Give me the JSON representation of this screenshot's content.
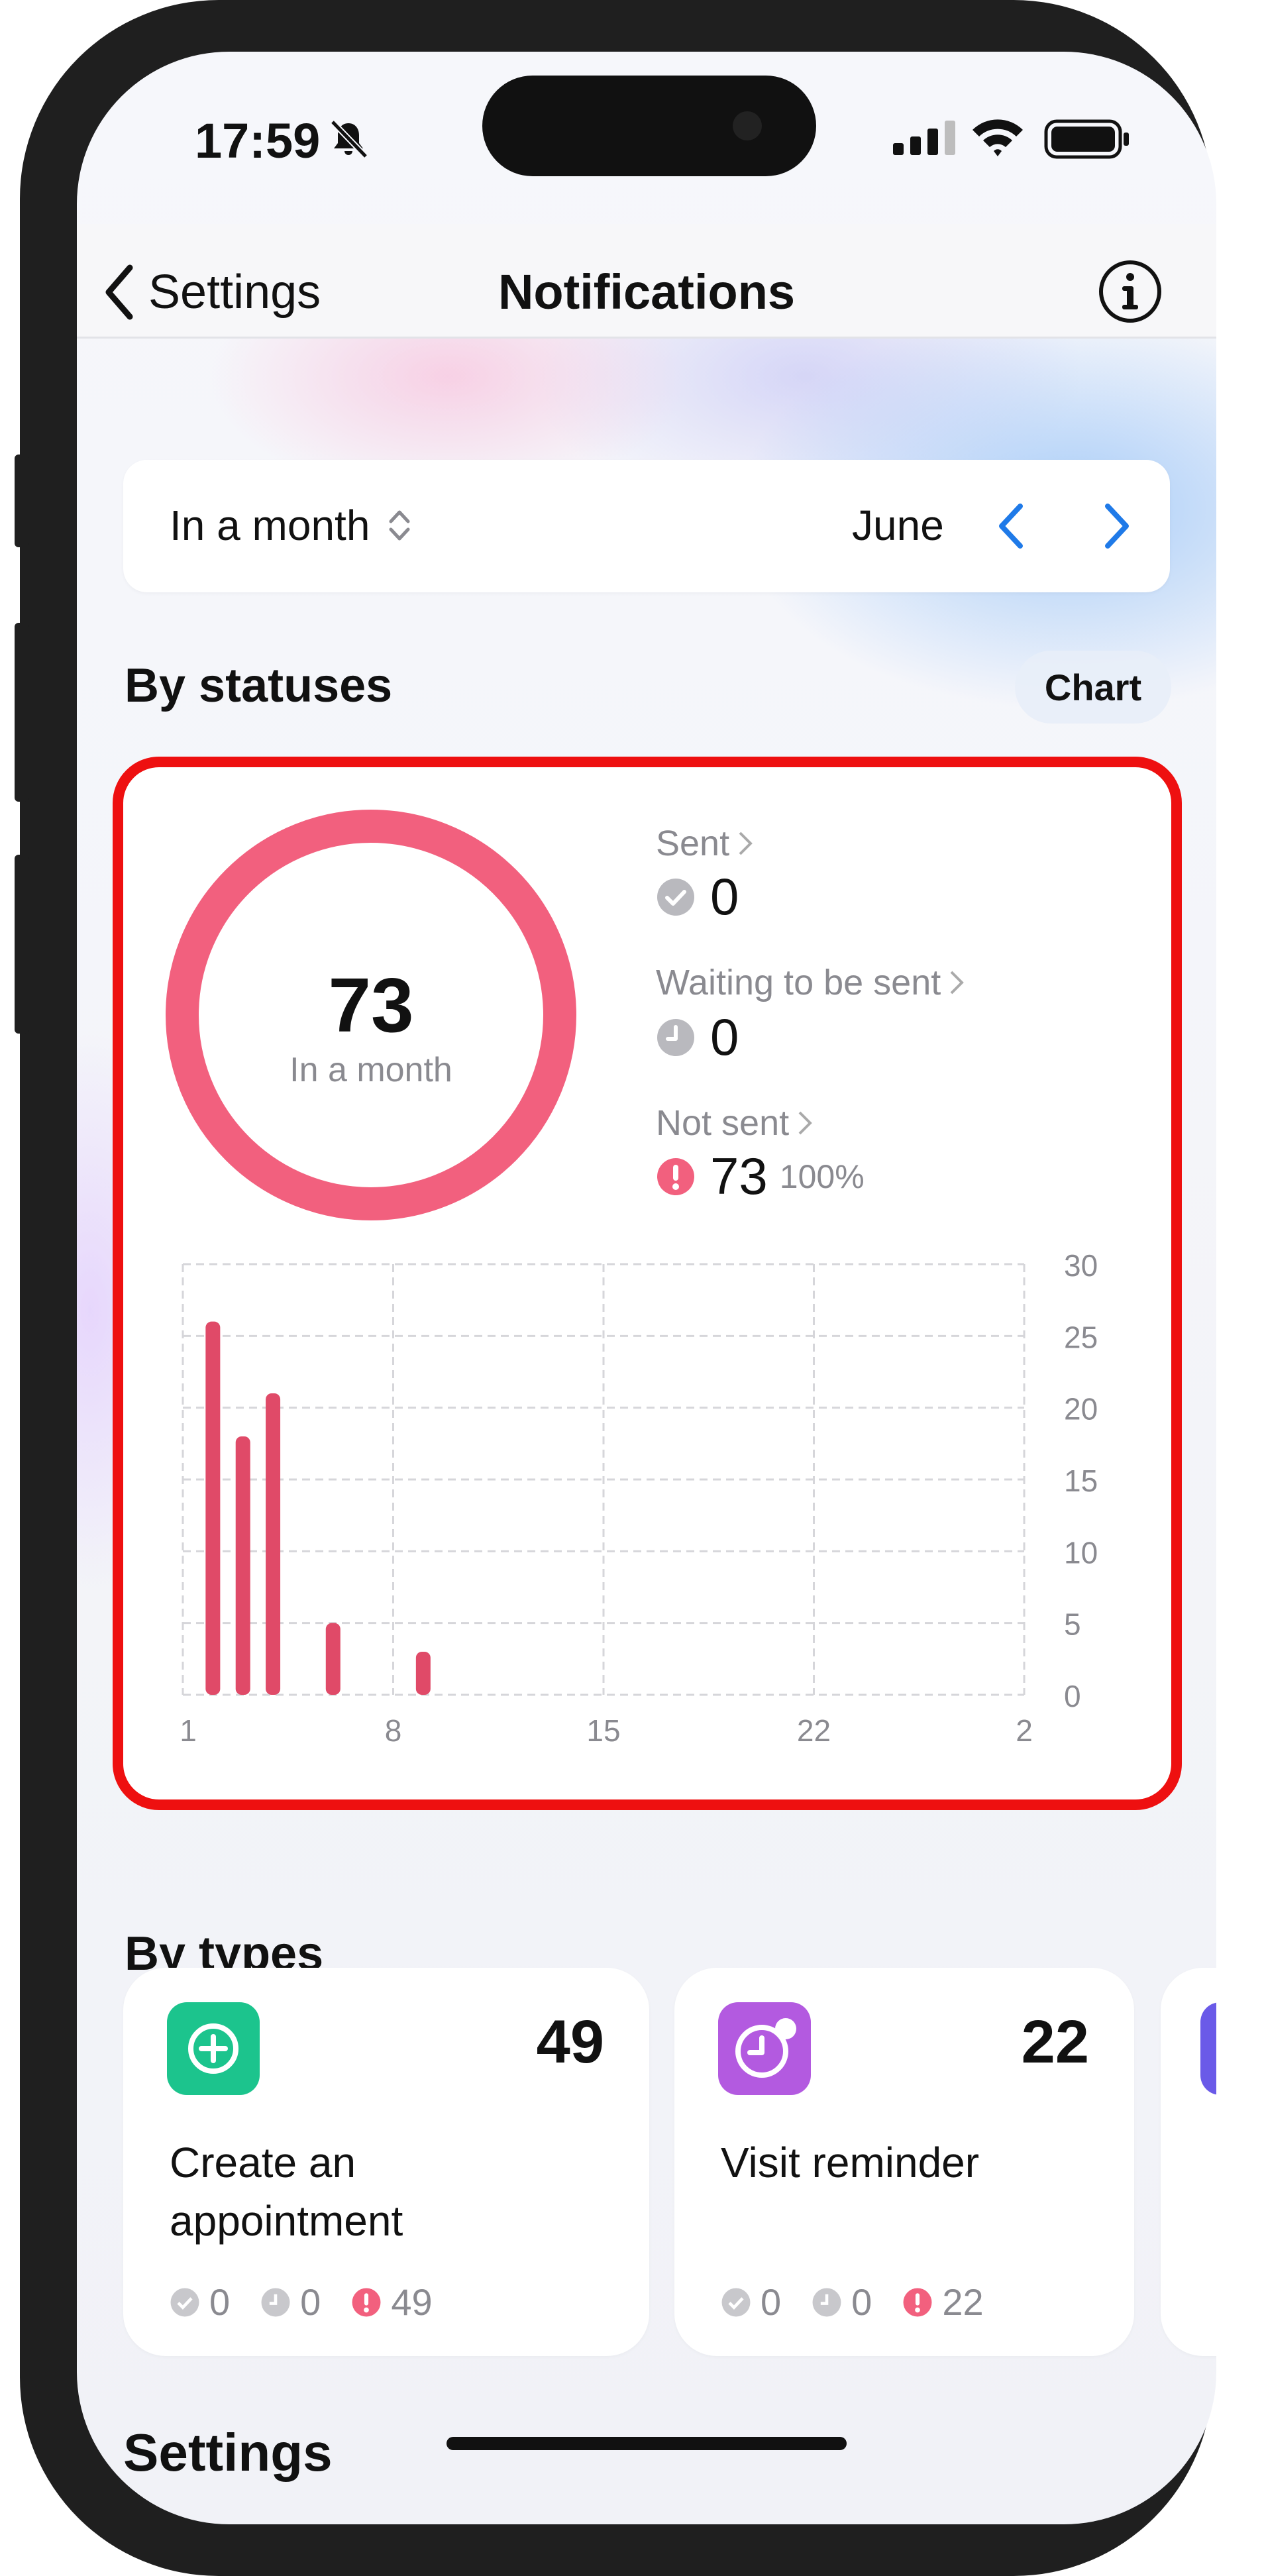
{
  "status_bar": {
    "time": "17:59"
  },
  "nav": {
    "back_label": "Settings",
    "title": "Notifications"
  },
  "period": {
    "mode": "In a month",
    "month": "June"
  },
  "statuses": {
    "title": "By statuses",
    "chart_button": "Chart",
    "total": "73",
    "total_caption": "In a month",
    "sent": {
      "label": "Sent",
      "value": "0"
    },
    "waiting": {
      "label": "Waiting to be sent",
      "value": "0"
    },
    "not_sent": {
      "label": "Not sent",
      "value": "73",
      "percent": "100%"
    },
    "colors": {
      "accent": "#f2607e",
      "grey": "#b9b9be"
    }
  },
  "chart_data": {
    "type": "bar",
    "x": [
      2,
      3,
      4,
      6,
      9
    ],
    "values": [
      26,
      18,
      21,
      5,
      3
    ],
    "xticks": [
      "1",
      "8",
      "15",
      "22",
      "2"
    ],
    "yticks": [
      "0",
      "5",
      "10",
      "15",
      "20",
      "25",
      "30"
    ],
    "ylim": [
      0,
      30
    ],
    "grid": true,
    "color": "#e04a68"
  },
  "types": {
    "title": "By types",
    "items": [
      {
        "name": "Create an appointment",
        "count": "49",
        "sent": "0",
        "waiting": "0",
        "not_sent": "49",
        "icon": "plus-icon",
        "color": "#1cc48d"
      },
      {
        "name": "Visit reminder",
        "count": "22",
        "sent": "0",
        "waiting": "0",
        "not_sent": "22",
        "icon": "clock-icon",
        "color": "#b35ae0"
      }
    ]
  },
  "settings": {
    "title": "Settings"
  }
}
